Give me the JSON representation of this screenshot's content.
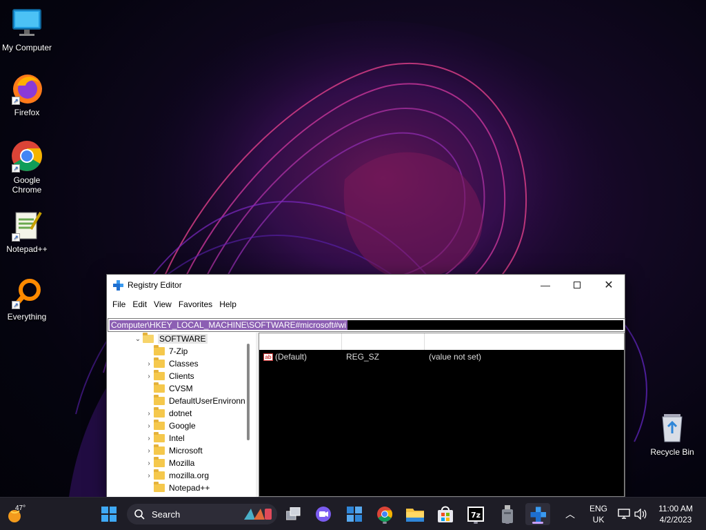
{
  "desktop": {
    "icons": [
      {
        "label": "My Computer",
        "icon": "monitor-icon"
      },
      {
        "label": "Firefox",
        "icon": "firefox-icon"
      },
      {
        "label": "Google Chrome",
        "icon": "chrome-icon"
      },
      {
        "label": "Notepad++",
        "icon": "notepadpp-icon"
      },
      {
        "label": "Everything",
        "icon": "magnifier-icon"
      },
      {
        "label": "Recycle Bin",
        "icon": "recycle-bin-icon"
      }
    ]
  },
  "window": {
    "title": "Registry Editor",
    "menu": [
      "File",
      "Edit",
      "View",
      "Favorites",
      "Help"
    ],
    "address": "Computer\\HKEY_LOCAL_MACHINE\\SOFTWARE#microsoft#wi",
    "tree": {
      "root": "SOFTWARE",
      "children": [
        {
          "name": "7-Zip",
          "expandable": false
        },
        {
          "name": "Classes",
          "expandable": true
        },
        {
          "name": "Clients",
          "expandable": true
        },
        {
          "name": "CVSM",
          "expandable": false
        },
        {
          "name": "DefaultUserEnvironn",
          "expandable": false
        },
        {
          "name": "dotnet",
          "expandable": true
        },
        {
          "name": "Google",
          "expandable": true
        },
        {
          "name": "Intel",
          "expandable": true
        },
        {
          "name": "Microsoft",
          "expandable": true
        },
        {
          "name": "Mozilla",
          "expandable": true
        },
        {
          "name": "mozilla.org",
          "expandable": true
        },
        {
          "name": "Notepad++",
          "expandable": false
        }
      ]
    },
    "values": [
      {
        "name": "(Default)",
        "type": "REG_SZ",
        "data": "(value not set)"
      }
    ]
  },
  "taskbar": {
    "weather_temp": "47°",
    "search_placeholder": "Search",
    "apps": [
      "start-icon",
      "task-view-icon",
      "chat-icon",
      "widgets-icon",
      "chrome-icon",
      "file-explorer-icon",
      "store-icon",
      "7zip-icon",
      "usb-drive-icon",
      "registry-editor-icon"
    ],
    "language": "ENG",
    "region": "UK",
    "time": "11:00 AM",
    "date": "4/2/2023"
  }
}
